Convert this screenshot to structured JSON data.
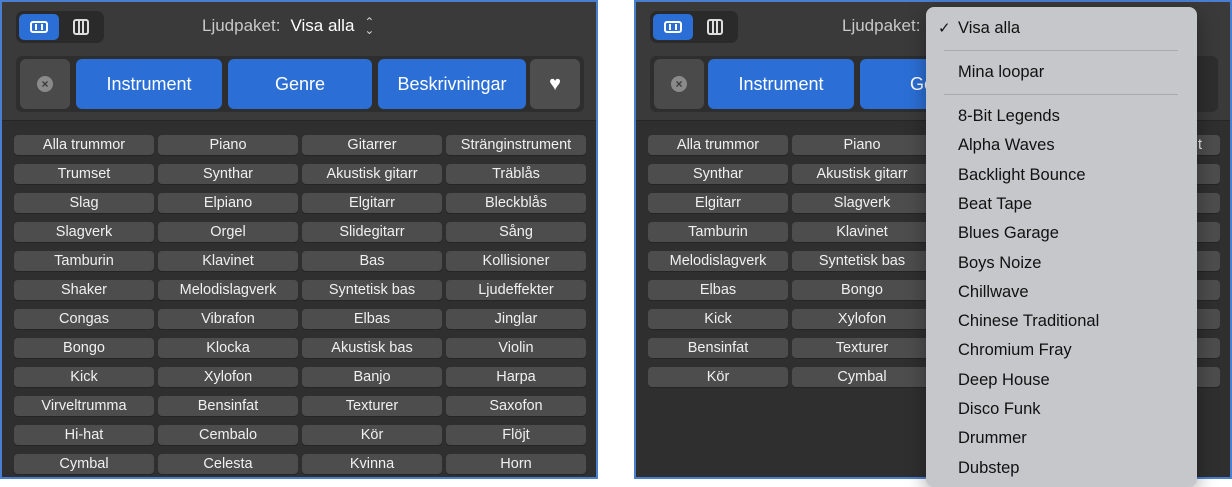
{
  "pack_label": "Ljudpaket:",
  "pack_value": "Visa alla",
  "filter_buttons": [
    "Instrument",
    "Genre",
    "Beskrivningar"
  ],
  "tags": [
    [
      "Alla trummor",
      "Piano",
      "Gitarrer",
      "Stränginstrument"
    ],
    [
      "Trumset",
      "Synthar",
      "Akustisk gitarr",
      "Träblås"
    ],
    [
      "Slag",
      "Elpiano",
      "Elgitarr",
      "Bleckblås"
    ],
    [
      "Slagverk",
      "Orgel",
      "Slidegitarr",
      "Sång"
    ],
    [
      "Tamburin",
      "Klavinet",
      "Bas",
      "Kollisioner"
    ],
    [
      "Shaker",
      "Melodislagverk",
      "Syntetisk bas",
      "Ljudeffekter"
    ],
    [
      "Congas",
      "Vibrafon",
      "Elbas",
      "Jinglar"
    ],
    [
      "Bongo",
      "Klocka",
      "Akustisk bas",
      "Violin"
    ],
    [
      "Kick",
      "Xylofon",
      "Banjo",
      "Harpa"
    ],
    [
      "Virveltrumma",
      "Bensinfat",
      "Texturer",
      "Saxofon"
    ],
    [
      "Hi-hat",
      "Cembalo",
      "Kör",
      "Flöjt"
    ],
    [
      "Cymbal",
      "Celesta",
      "Kvinna",
      "Horn"
    ]
  ],
  "right_col4_partial": "t",
  "dropdown": {
    "selected": "Visa alla",
    "mine": "Mina loopar",
    "packs": [
      "8-Bit Legends",
      "Alpha Waves",
      "Backlight Bounce",
      "Beat Tape",
      "Blues Garage",
      "Boys Noize",
      "Chillwave",
      "Chinese Traditional",
      "Chromium Fray",
      "Deep House",
      "Disco Funk",
      "Drummer",
      "Dubstep"
    ]
  },
  "colors": {
    "accent": "#2b6fd6",
    "panel": "#3a3a3a",
    "tag": "#4d4d4d",
    "menu": "#c6c7ca"
  }
}
